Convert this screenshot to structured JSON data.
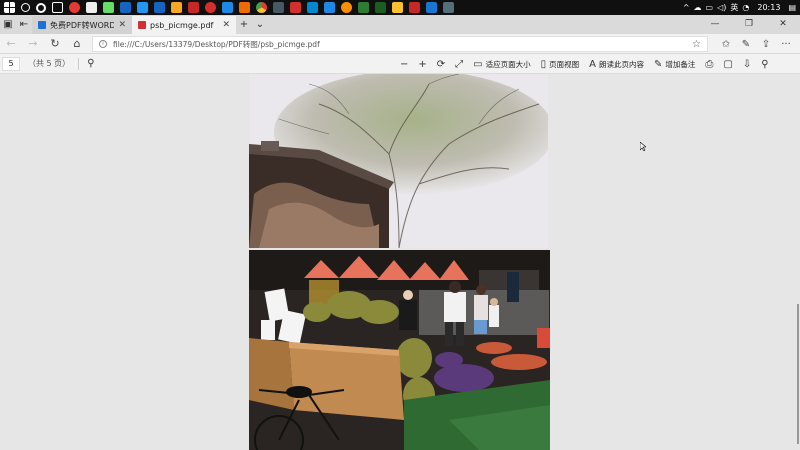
{
  "taskbar": {
    "clock": "20:13",
    "ime": "英",
    "app_icons": [
      "search-icon",
      "cortana-icon",
      "task-view-icon",
      "app-icon",
      "file-icon",
      "app-icon",
      "folder-icon",
      "browser-icon",
      "app-icon",
      "chrome-icon",
      "app-icon",
      "edge-icon",
      "app-icon",
      "app-icon",
      "app-icon",
      "app-icon",
      "app-icon",
      "app-icon",
      "app-icon",
      "app-icon",
      "app-icon",
      "app-icon",
      "app-icon"
    ],
    "colors": {
      "bg": "#101010"
    }
  },
  "tabs": [
    {
      "label": "免费PDF转WORD工具|PDF转",
      "active": false,
      "favicon_color": "#1e6fd9"
    },
    {
      "label": "psb_picmge.pdf",
      "active": true,
      "favicon_color": "#d32f2f"
    }
  ],
  "tab_actions": {
    "new_tab": "+",
    "tab_list": "⌄"
  },
  "window_controls": {
    "minimize": "—",
    "restore": "❐",
    "close": "✕"
  },
  "addressbar": {
    "url": "file:///C:/Users/13379/Desktop/PDF转图/psb_picmge.pdf",
    "back": "←",
    "forward": "→",
    "refresh": "↻",
    "home": "⌂",
    "favorite": "☆"
  },
  "addr_right_icons": {
    "favorites": "✩",
    "notes": "✎",
    "share": "⇪",
    "more": "···"
  },
  "pdf_toolbar": {
    "page_number": "5",
    "page_count": "（共 5 页）",
    "zoom_out": "−",
    "zoom_in": "+",
    "rotate": "⟳",
    "fullscreen": "⤢",
    "fit_page_label": "适应页面大小",
    "page_view_label": "页面视图",
    "read_aloud_label": "朗读此页内容",
    "add_notes_label": "增加备注",
    "print": "⎙",
    "save": "▢",
    "save_as": "⇩",
    "pin": "⚲"
  },
  "document": {
    "file_name": "psb_picmge.pdf",
    "images": [
      "tree-over-old-building-photo",
      "market-stall-durian-photo"
    ]
  }
}
